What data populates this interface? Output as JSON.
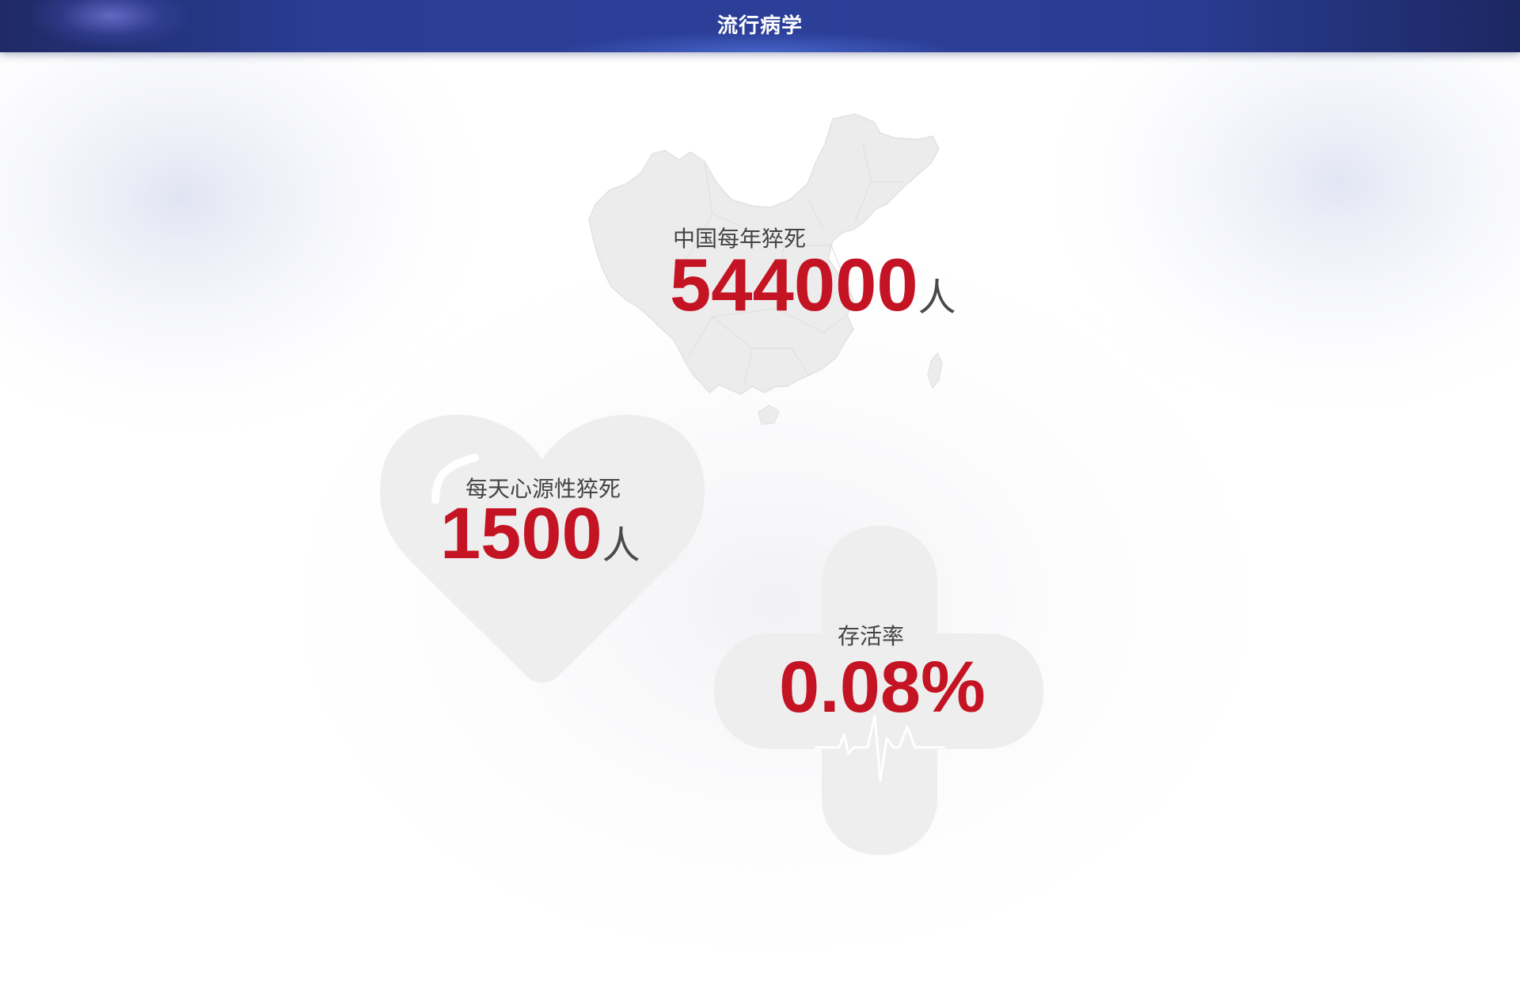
{
  "header": {
    "title": "流行病学"
  },
  "stats": {
    "china": {
      "label": "中国每年猝死",
      "value": "544000",
      "unit": "人",
      "icon": "china-map-icon"
    },
    "daily": {
      "label": "每天心源性猝死",
      "value": "1500",
      "unit": "人",
      "icon": "heart-icon"
    },
    "survival": {
      "label": "存活率",
      "value": "0.08%",
      "icon": "medical-cross-icon"
    }
  },
  "colors": {
    "header": "#2b3d96",
    "accent": "#c41424",
    "shape_fill": "#eeeeee",
    "label_text": "#444444"
  }
}
